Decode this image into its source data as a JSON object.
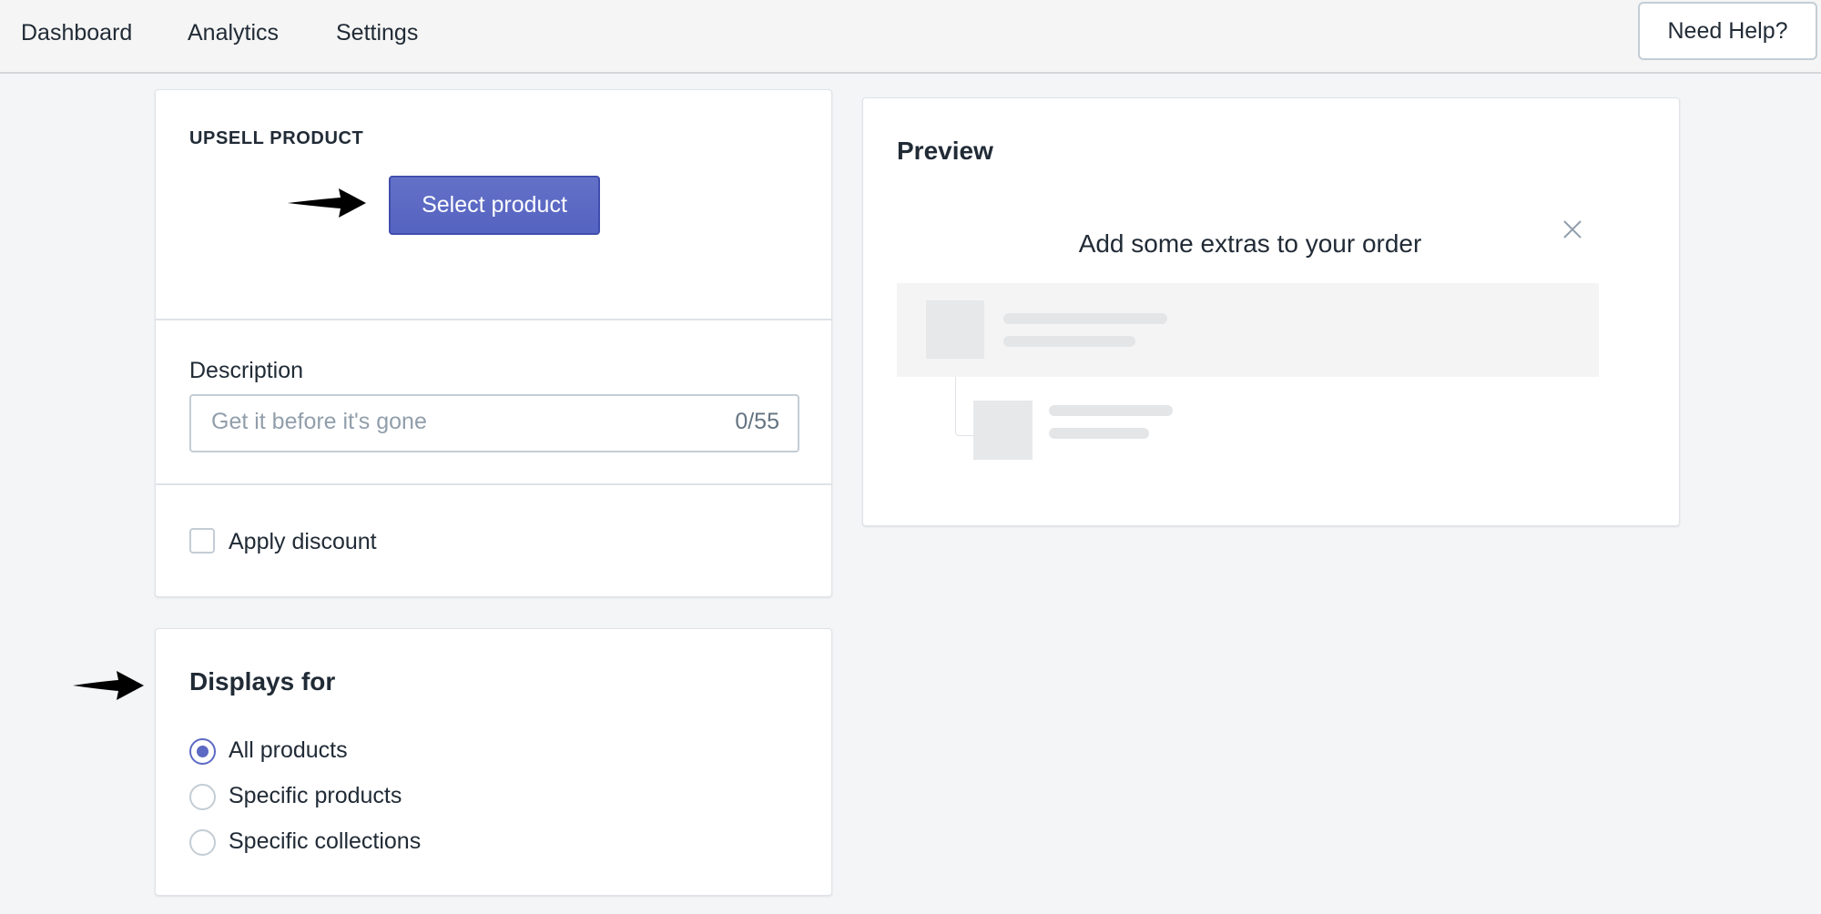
{
  "nav": {
    "items": [
      {
        "label": "Dashboard"
      },
      {
        "label": "Analytics"
      },
      {
        "label": "Settings"
      }
    ],
    "help_label": "Need Help?"
  },
  "upsell": {
    "heading": "UPSELL PRODUCT",
    "select_label": "Select product"
  },
  "description": {
    "label": "Description",
    "placeholder": "Get it before it's gone",
    "value": "",
    "counter": "0/55"
  },
  "discount": {
    "label": "Apply discount",
    "checked": false
  },
  "displays_for": {
    "heading": "Displays for",
    "options": [
      {
        "label": "All products",
        "selected": true
      },
      {
        "label": "Specific products",
        "selected": false
      },
      {
        "label": "Specific collections",
        "selected": false
      }
    ]
  },
  "preview": {
    "heading": "Preview",
    "banner_text": "Add some extras to your order"
  },
  "colors": {
    "accent": "#5c6ac4",
    "button_border": "#3f4eae",
    "text": "#212b36",
    "placeholder": "#919eab"
  },
  "icons": [
    "arrow-right-icon",
    "close-icon"
  ]
}
